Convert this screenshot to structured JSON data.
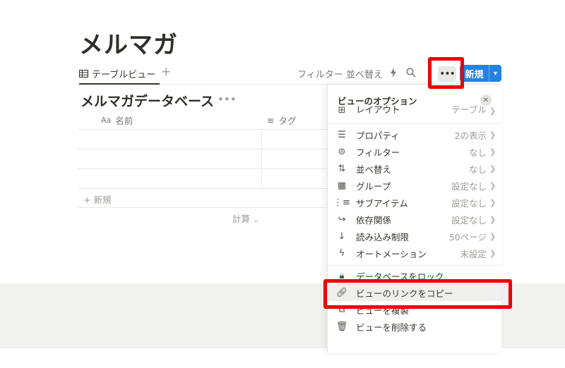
{
  "page": {
    "title": "メルマガ"
  },
  "tabs": {
    "table_view": "テーブルビュー",
    "add": "+"
  },
  "toolbar": {
    "filter": "フィルター",
    "sort": "並べ替え",
    "more": "•••",
    "new_label": "新規"
  },
  "database": {
    "title": "メルマガデータベース",
    "dots": "•••",
    "columns": [
      {
        "prefix": "Aa",
        "label": "名前"
      },
      {
        "prefix": "≡",
        "label": "タグ"
      }
    ],
    "add_row": "+ 新規",
    "calc": "計算"
  },
  "menu": {
    "title": "ビューのオプション",
    "close": "✕",
    "layout": {
      "label": "レイアウト",
      "value": "テーブル"
    },
    "settings": [
      {
        "label": "プロパティ",
        "value": "2の表示"
      },
      {
        "label": "フィルター",
        "value": "なし"
      },
      {
        "label": "並べ替え",
        "value": "なし"
      },
      {
        "label": "グループ",
        "value": "設定なし"
      },
      {
        "label": "サブアイテム",
        "value": "設定なし"
      },
      {
        "label": "依存関係",
        "value": "設定なし"
      },
      {
        "label": "読み込み制限",
        "value": "50ページ"
      },
      {
        "label": "オートメーション",
        "value": "未設定"
      }
    ],
    "actions": [
      {
        "label": "データベースをロック"
      },
      {
        "label": "ビューのリンクをコピー"
      },
      {
        "label": "ビューを複製"
      },
      {
        "label": "ビューを削除する"
      }
    ]
  },
  "colors": {
    "accent": "#2383e2",
    "highlight": "#ee0000"
  }
}
